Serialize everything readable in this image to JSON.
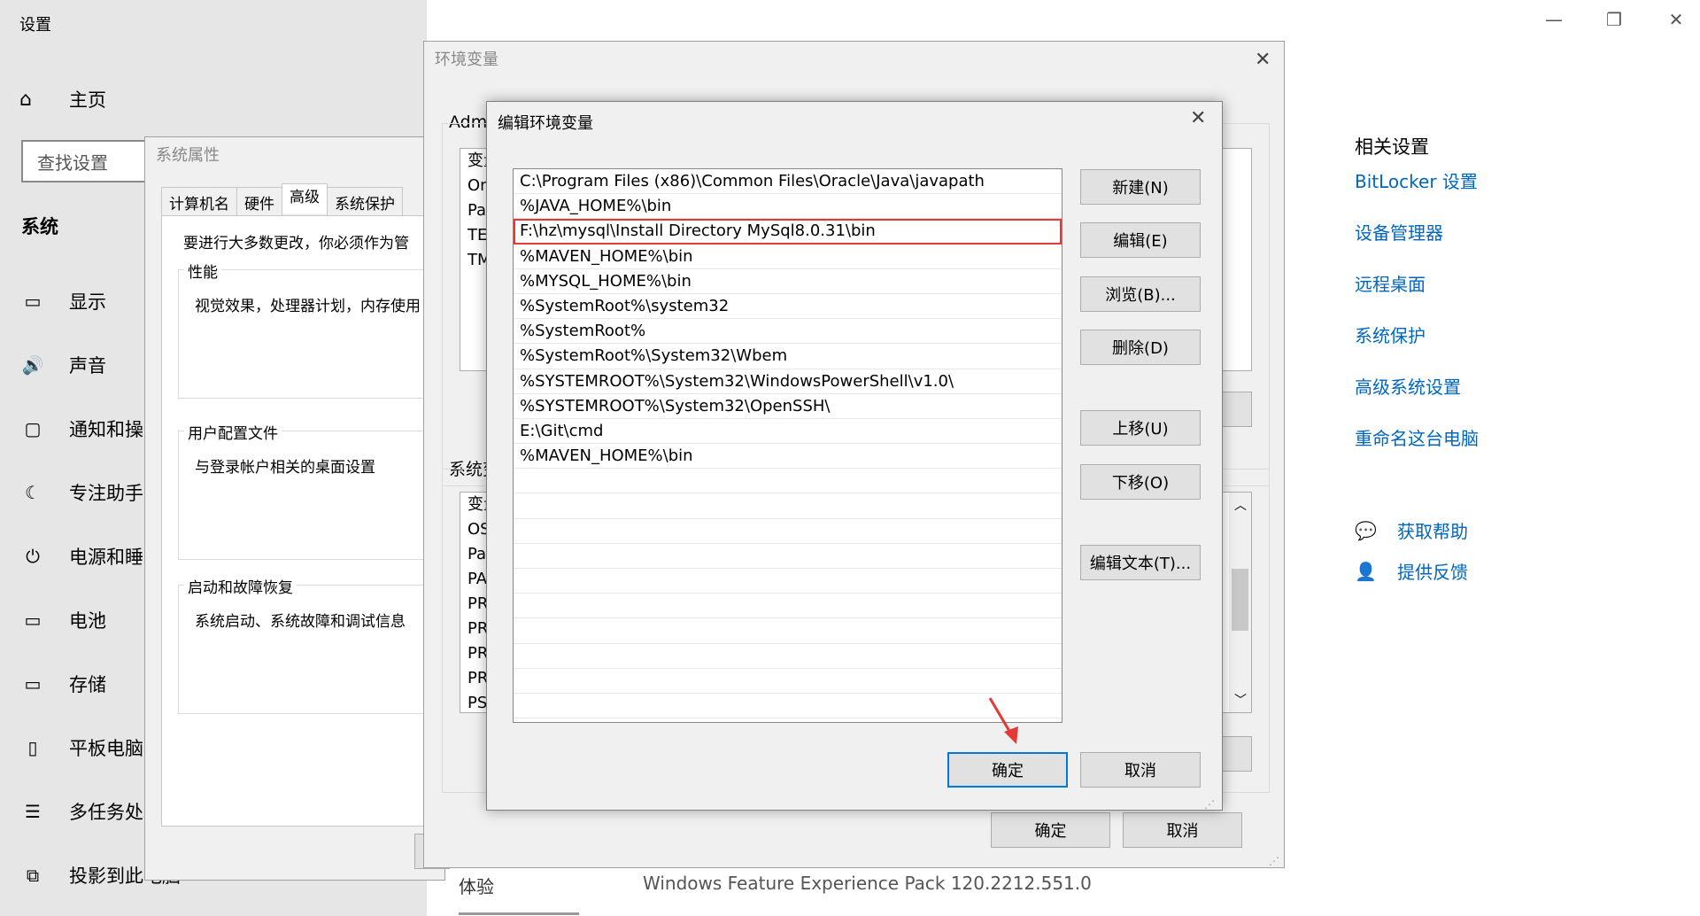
{
  "settings": {
    "title": "设置",
    "home": "主页",
    "search_placeholder": "查找设置",
    "section": "系统",
    "nav": [
      {
        "label": "显示",
        "icon": "monitor-icon"
      },
      {
        "label": "声音",
        "icon": "speaker-icon"
      },
      {
        "label": "通知和操作",
        "icon": "notification-icon"
      },
      {
        "label": "专注助手",
        "icon": "moon-icon"
      },
      {
        "label": "电源和睡眠",
        "icon": "power-icon"
      },
      {
        "label": "电池",
        "icon": "battery-icon"
      },
      {
        "label": "存储",
        "icon": "storage-icon"
      },
      {
        "label": "平板电脑",
        "icon": "tablet-icon"
      },
      {
        "label": "多任务处理",
        "icon": "multitask-icon"
      },
      {
        "label": "投影到此电脑",
        "icon": "project-icon"
      }
    ],
    "related": {
      "title": "相关设置",
      "links": [
        "BitLocker 设置",
        "设备管理器",
        "远程桌面",
        "系统保护",
        "高级系统设置",
        "重命名这台电脑"
      ]
    },
    "help": {
      "get_help": "获取帮助",
      "feedback": "提供反馈"
    },
    "bottom": {
      "label": "体验",
      "value": "Windows Feature Experience Pack 120.2212.551.0"
    }
  },
  "sysprops": {
    "title": "系统属性",
    "tabs": [
      "计算机名",
      "硬件",
      "高级",
      "系统保护"
    ],
    "active_tab": "高级",
    "intro": "要进行大多数更改，你必须作为管",
    "groups": [
      {
        "label": "性能",
        "text": "视觉效果，处理器计划，内存使用"
      },
      {
        "label": "用户配置文件",
        "text": "与登录帐户相关的桌面设置"
      },
      {
        "label": "启动和故障恢复",
        "text": "系统启动、系统故障和调试信息"
      }
    ]
  },
  "envvars": {
    "title": "环境变量",
    "user_label": "Adm",
    "user_rows": [
      "变量",
      "On",
      "Pat",
      "TEI",
      "TM"
    ],
    "sys_label": "系统变",
    "sys_rows": [
      "变量",
      "OS",
      "Pat",
      "PA",
      "PR",
      "PR",
      "PR",
      "PR",
      "PS"
    ],
    "ok": "确定",
    "cancel": "取消"
  },
  "edit": {
    "title": "编辑环境变量",
    "paths": [
      "C:\\Program Files (x86)\\Common Files\\Oracle\\Java\\javapath",
      "%JAVA_HOME%\\bin",
      "F:\\hz\\mysql\\Install Directory MySql8.0.31\\bin",
      "%MAVEN_HOME%\\bin",
      "%MYSQL_HOME%\\bin",
      "%SystemRoot%\\system32",
      "%SystemRoot%",
      "%SystemRoot%\\System32\\Wbem",
      "%SYSTEMROOT%\\System32\\WindowsPowerShell\\v1.0\\",
      "%SYSTEMROOT%\\System32\\OpenSSH\\",
      "E:\\Git\\cmd",
      "%MAVEN_HOME%\\bin",
      "",
      "",
      "",
      "",
      "",
      "",
      "",
      "",
      "",
      ""
    ],
    "selected_index": 2,
    "buttons": {
      "new": "新建(N)",
      "edit": "编辑(E)",
      "browse": "浏览(B)...",
      "delete": "删除(D)",
      "up": "上移(U)",
      "down": "下移(O)",
      "edit_text": "编辑文本(T)..."
    },
    "ok": "确定",
    "cancel": "取消"
  },
  "colors": {
    "accent": "#0067c0",
    "highlight": "#e53935",
    "focus": "#0078d7"
  }
}
